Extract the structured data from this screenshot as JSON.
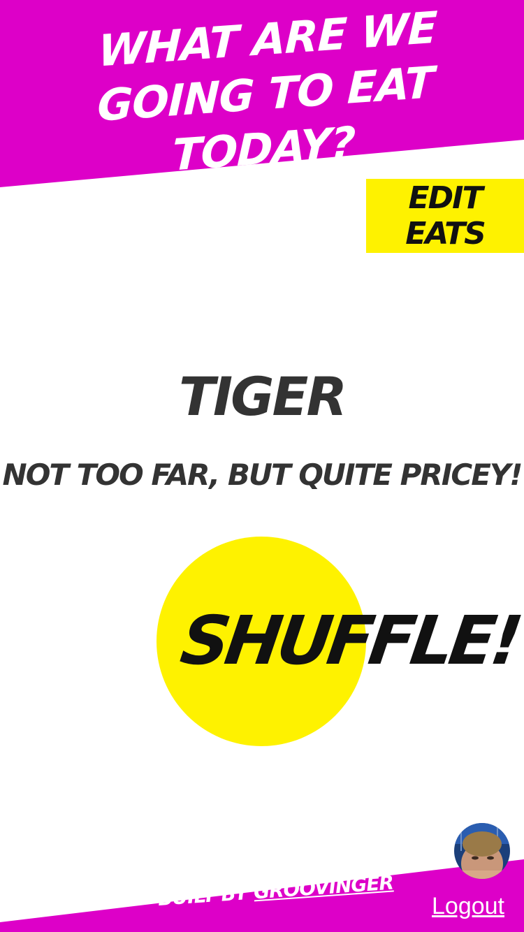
{
  "colors": {
    "brand": "#dd00c8",
    "accent": "#fef200",
    "text_dark": "#333333",
    "text_black": "#111111",
    "background": "#ffffff"
  },
  "header": {
    "title": "What are we going to eat today?"
  },
  "toolbar": {
    "edit_label": "Edit Eats"
  },
  "result": {
    "name": "Tiger",
    "description": "Not too far, but quite pricey!"
  },
  "shuffle": {
    "label": "Shuffle!"
  },
  "footer": {
    "credit_prefix": "Built by ",
    "author": "Groovinger",
    "logout_label": "Logout",
    "avatar_icon": "user-avatar"
  }
}
